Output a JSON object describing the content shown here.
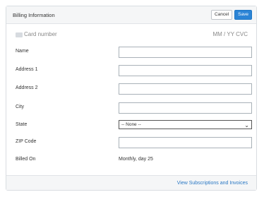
{
  "panel": {
    "title": "Billing Information",
    "cancel_label": "Cancel",
    "save_label": "Save"
  },
  "card": {
    "placeholder": "Card number",
    "expiry_cvc": "MM / YY  CVC"
  },
  "fields": {
    "name": "Name",
    "address1": "Address 1",
    "address2": "Address 2",
    "city": "City",
    "state": "State",
    "zip": "ZIP Code",
    "billed_on": "Billed On"
  },
  "state_select": {
    "selected": "-- None --"
  },
  "billed_on_value": "Monthly, day 25",
  "footer": {
    "link": "View Subscriptions and Invoices"
  },
  "icons": {
    "card": "credit-card-icon",
    "select_caret": "chevron-down-icon"
  },
  "colors": {
    "primary": "#2b84d6",
    "link": "#2a78c4"
  }
}
